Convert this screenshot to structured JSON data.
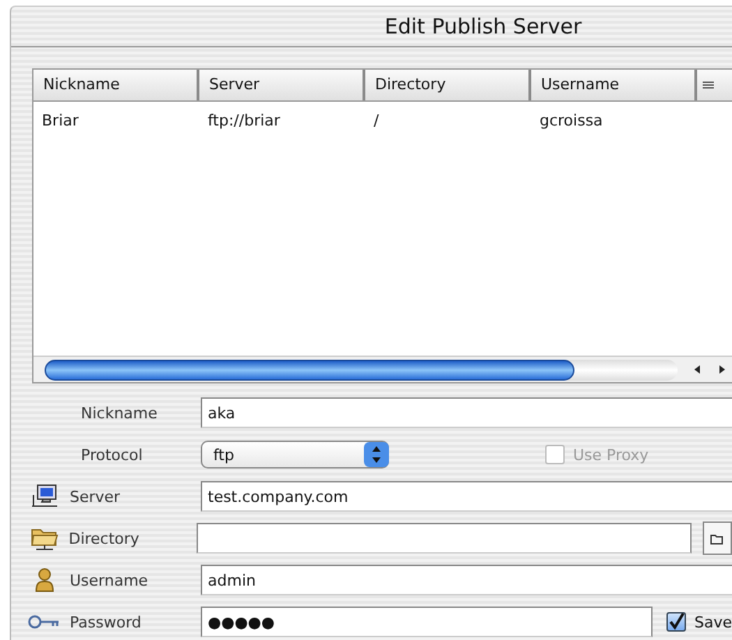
{
  "window": {
    "title": "Edit Publish Server"
  },
  "table": {
    "columns": [
      "Nickname",
      "Server",
      "Directory",
      "Username"
    ],
    "rows": [
      {
        "cells": [
          "Briar",
          "ftp://briar",
          "/",
          "gcroissa"
        ]
      }
    ]
  },
  "fields": [
    {
      "label": "Nickname",
      "kind": "text",
      "value": "aka"
    },
    {
      "label": "Protocol",
      "kind": "select",
      "value": "ftp"
    },
    {
      "label": "Server",
      "kind": "text",
      "value": "test.company.com"
    },
    {
      "label": "Directory",
      "kind": "browse"
    },
    {
      "label": "Username",
      "kind": "text",
      "value": "admin"
    },
    {
      "label": "Password",
      "kind": "password",
      "value": "●●●●●"
    }
  ],
  "use_proxy": {
    "label": "Use Proxy",
    "checked": false,
    "disabled": true
  },
  "save_password": {
    "label": "Save",
    "checked": true
  }
}
